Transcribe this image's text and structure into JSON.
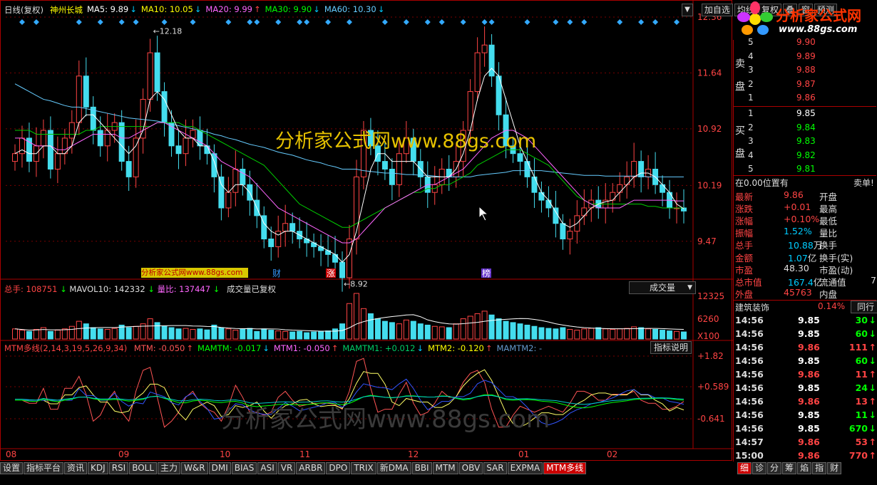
{
  "header": {
    "period": "日线(复权)",
    "stock_name": "神州长城",
    "ma": [
      {
        "label": "MA5: 9.89",
        "dir": "↓",
        "color": "#ffffff"
      },
      {
        "label": "MA10: 10.05",
        "dir": "↓",
        "color": "#ffff00"
      },
      {
        "label": "MA20: 9.99",
        "dir": "↑",
        "color": "#ff66ff"
      },
      {
        "label": "MA30: 9.90",
        "dir": "↓",
        "color": "#00ff00"
      },
      {
        "label": "MA60: 10.30",
        "dir": "↓",
        "color": "#66ccff"
      }
    ],
    "buttons": [
      "加自选",
      "均线",
      "复权",
      "叠",
      "窗",
      "预测"
    ]
  },
  "logo": {
    "title": "分析家公式网",
    "url": "www.88gs.com"
  },
  "watermark": "分析家公式网www.88gs.com",
  "watermark_box": "分析家公式网www.88gs.com",
  "price_axis": [
    "12.36",
    "11.64",
    "10.92",
    "10.19",
    "9.47"
  ],
  "annotations": {
    "high": "12.18",
    "low": "8.92",
    "tag_cai": "财",
    "tag_zhang": "涨",
    "tag_bang": "榜"
  },
  "volume_panel": {
    "total_label": "总手: 108751",
    "mavol_label": "MAVOL10: 142332",
    "lb_label": "量比: 137447",
    "note": "成交量已复权",
    "dropdown": "成交量",
    "axis": [
      "12325",
      "6260",
      "X100"
    ]
  },
  "mtm_panel": {
    "name": "MTM多线(2,14,3,19,5,26,9,34)",
    "items": [
      {
        "label": "MTM: -0.050",
        "dir": "↑",
        "color": "#ff5555"
      },
      {
        "label": "MAMTM: -0.017",
        "dir": "↓",
        "color": "#00ff00"
      },
      {
        "label": "MTM1: -0.050",
        "dir": "↑",
        "color": "#ff66ff"
      },
      {
        "label": "MAMTM1: +0.012",
        "dir": "↓",
        "color": "#00cc66"
      },
      {
        "label": "MTM2: -0.120",
        "dir": "↑",
        "color": "#ffff00"
      },
      {
        "label": "MAMTM2: -",
        "dir": "",
        "color": "#6699cc"
      }
    ],
    "help_button": "指标说明",
    "axis": [
      "+1.82",
      "+0.589",
      "-0.641"
    ]
  },
  "date_axis": [
    "08",
    "09",
    "10",
    "11",
    "12",
    "01",
    "02"
  ],
  "bottom_tabs": [
    "设置",
    "指标平台",
    "资讯",
    "KDJ",
    "RSI",
    "BOLL",
    "主力",
    "W&R",
    "DMI",
    "BIAS",
    "ASI",
    "VR",
    "ARBR",
    "DPO",
    "TRIX",
    "新DMA",
    "BBI",
    "MTM",
    "OBV",
    "SAR",
    "EXPMA",
    "MTM多线"
  ],
  "right_tabs": [
    "细",
    "诊",
    "分",
    "筹",
    "焰",
    "指",
    "财"
  ],
  "order_book": {
    "sell_label": [
      "卖",
      "盘"
    ],
    "buy_label": [
      "买",
      "盘"
    ],
    "sell": [
      {
        "n": "5",
        "p": "9.90"
      },
      {
        "n": "4",
        "p": "9.89"
      },
      {
        "n": "3",
        "p": "9.88"
      },
      {
        "n": "2",
        "p": "9.87"
      },
      {
        "n": "1",
        "p": "9.86"
      }
    ],
    "buy": [
      {
        "n": "1",
        "p": "9.85"
      },
      {
        "n": "2",
        "p": "9.84"
      },
      {
        "n": "3",
        "p": "9.83"
      },
      {
        "n": "4",
        "p": "9.82"
      },
      {
        "n": "5",
        "p": "9.81"
      }
    ]
  },
  "position": {
    "left": "在0.00位置有",
    "right": "卖单!"
  },
  "quote": [
    {
      "k": "最新",
      "v": "9.86",
      "vc": "#ff4444",
      "k2": "开盘"
    },
    {
      "k": "涨跌",
      "v": "+0.01",
      "vc": "#ff4444",
      "k2": "最高"
    },
    {
      "k": "涨幅",
      "v": "+0.10%",
      "vc": "#ff4444",
      "k2": "最低"
    },
    {
      "k": "振幅",
      "v": "1.52%",
      "vc": "#00ccff",
      "k2": "量比"
    },
    {
      "k": "总手",
      "v": "10.88",
      "u": "万",
      "vc": "#00ccff",
      "k2": "换手"
    },
    {
      "k": "金额",
      "v": "1.07",
      "u": "亿",
      "vc": "#00ccff",
      "k2": "换手(实)"
    },
    {
      "k": "市盈",
      "v": "48.30",
      "vc": "#dddddd",
      "k2": "市盈(动)"
    },
    {
      "k": "总市值",
      "v": "167.4",
      "u": "亿",
      "vc": "#00ccff",
      "k2": "流通值",
      "extra": "7"
    },
    {
      "k": "外盘",
      "v": "45763",
      "vc": "#ff4444",
      "k2": "内盘"
    }
  ],
  "sector": {
    "name": "建筑装饰",
    "pct": "0.14%",
    "btn": "同行"
  },
  "ticks": [
    {
      "t": "14:56",
      "p": "9.85",
      "pc": "#ffffff",
      "v": "30",
      "d": "↓",
      "c": "#00ff00"
    },
    {
      "t": "14:56",
      "p": "9.85",
      "pc": "#ffffff",
      "v": "60",
      "d": "↓",
      "c": "#00ff00"
    },
    {
      "t": "14:56",
      "p": "9.86",
      "pc": "#ff4444",
      "v": "111",
      "d": "↑",
      "c": "#ff4444"
    },
    {
      "t": "14:56",
      "p": "9.85",
      "pc": "#ffffff",
      "v": "60",
      "d": "↓",
      "c": "#00ff00"
    },
    {
      "t": "14:56",
      "p": "9.86",
      "pc": "#ff4444",
      "v": "11",
      "d": "↑",
      "c": "#ff4444"
    },
    {
      "t": "14:56",
      "p": "9.85",
      "pc": "#ffffff",
      "v": "24",
      "d": "↓",
      "c": "#00ff00"
    },
    {
      "t": "14:56",
      "p": "9.86",
      "pc": "#ff4444",
      "v": "13",
      "d": "↑",
      "c": "#ff4444"
    },
    {
      "t": "14:56",
      "p": "9.85",
      "pc": "#ffffff",
      "v": "11",
      "d": "↓",
      "c": "#00ff00"
    },
    {
      "t": "14:56",
      "p": "9.85",
      "pc": "#ffffff",
      "v": "670",
      "d": "↓",
      "c": "#00ff00"
    },
    {
      "t": "14:57",
      "p": "9.86",
      "pc": "#ff4444",
      "v": "53",
      "d": "↑",
      "c": "#ff4444"
    },
    {
      "t": "15:00",
      "p": "9.86",
      "pc": "#ff4444",
      "v": "770",
      "d": "↑",
      "c": "#ff4444"
    }
  ],
  "chart_data": {
    "type": "candlestick",
    "x": [
      "08",
      "09",
      "10",
      "11",
      "12",
      "01",
      "02"
    ],
    "ylim": [
      9.0,
      12.36
    ],
    "price_ticks": [
      12.36,
      11.64,
      10.92,
      10.19,
      9.47
    ],
    "high_marker": 12.18,
    "low_marker": 8.92,
    "close": [
      10.6,
      10.8,
      10.5,
      10.7,
      10.9,
      10.4,
      10.6,
      10.8,
      11.0,
      11.6,
      11.2,
      10.9,
      10.7,
      10.9,
      11.0,
      10.5,
      10.3,
      10.8,
      11.3,
      11.9,
      11.4,
      11.0,
      10.7,
      10.6,
      10.8,
      10.9,
      10.7,
      10.6,
      10.3,
      9.9,
      10.1,
      10.4,
      10.2,
      10.0,
      9.8,
      9.5,
      9.4,
      9.6,
      9.7,
      9.6,
      9.5,
      9.45,
      9.4,
      9.35,
      9.3,
      9.2,
      9.0,
      9.5,
      10.3,
      10.9,
      10.7,
      10.5,
      10.4,
      10.2,
      10.6,
      10.8,
      10.5,
      10.3,
      10.1,
      10.2,
      10.4,
      10.3,
      10.5,
      10.9,
      11.4,
      11.9,
      12.0,
      11.6,
      11.1,
      10.7,
      10.6,
      10.5,
      10.3,
      10.1,
      10.0,
      9.9,
      9.7,
      9.5,
      9.6,
      9.8,
      9.9,
      10.0,
      9.9,
      10.0,
      10.1,
      10.2,
      10.3,
      10.5,
      10.3,
      10.4,
      10.2,
      10.1,
      9.9,
      9.9,
      9.86
    ],
    "ma5": [
      10.6,
      10.65,
      10.6,
      10.6,
      10.7,
      10.7,
      10.6,
      10.6,
      10.7,
      11.0,
      11.1,
      11.1,
      11.0,
      10.9,
      10.8,
      10.7,
      10.6,
      10.7,
      10.9,
      11.3,
      11.4,
      11.3,
      11.1,
      10.9,
      10.8,
      10.8,
      10.7,
      10.7,
      10.5,
      10.2,
      10.1,
      10.2,
      10.2,
      10.1,
      9.9,
      9.7,
      9.6,
      9.55,
      9.6,
      9.6,
      9.55,
      9.5,
      9.45,
      9.4,
      9.35,
      9.3,
      9.2,
      9.3,
      9.6,
      10.0,
      10.4,
      10.6,
      10.6,
      10.5,
      10.5,
      10.5,
      10.5,
      10.4,
      10.3,
      10.3,
      10.3,
      10.3,
      10.4,
      10.6,
      10.9,
      11.3,
      11.6,
      11.7,
      11.6,
      11.3,
      11.0,
      10.7,
      10.5,
      10.3,
      10.1,
      10.0,
      9.85,
      9.7,
      9.65,
      9.7,
      9.8,
      9.9,
      9.95,
      9.98,
      10.0,
      10.1,
      10.2,
      10.3,
      10.35,
      10.35,
      10.3,
      10.2,
      10.1,
      9.95,
      9.89
    ],
    "ma20": [
      10.8,
      10.8,
      10.75,
      10.7,
      10.7,
      10.7,
      10.65,
      10.65,
      10.7,
      10.75,
      10.8,
      10.85,
      10.85,
      10.85,
      10.85,
      10.8,
      10.8,
      10.85,
      10.9,
      10.95,
      11.0,
      11.0,
      10.95,
      10.9,
      10.85,
      10.8,
      10.75,
      10.7,
      10.6,
      10.5,
      10.45,
      10.4,
      10.35,
      10.3,
      10.2,
      10.1,
      10.0,
      9.9,
      9.85,
      9.8,
      9.75,
      9.7,
      9.65,
      9.6,
      9.55,
      9.5,
      9.45,
      9.45,
      9.5,
      9.6,
      9.7,
      9.8,
      9.9,
      9.95,
      10.0,
      10.05,
      10.1,
      10.15,
      10.2,
      10.2,
      10.25,
      10.3,
      10.35,
      10.4,
      10.5,
      10.6,
      10.7,
      10.8,
      10.85,
      10.9,
      10.9,
      10.85,
      10.8,
      10.7,
      10.6,
      10.5,
      10.4,
      10.3,
      10.2,
      10.1,
      10.0,
      9.95,
      9.9,
      9.9,
      9.9,
      9.9,
      9.95,
      10.0,
      10.0,
      10.0,
      10.0,
      10.0,
      10.0,
      9.99,
      9.99
    ],
    "ma30": [
      10.9,
      10.9,
      10.9,
      10.85,
      10.85,
      10.85,
      10.85,
      10.85,
      10.85,
      10.85,
      10.9,
      10.9,
      10.95,
      10.95,
      10.95,
      10.95,
      10.95,
      10.95,
      10.95,
      10.95,
      11.0,
      11.0,
      11.0,
      11.0,
      10.95,
      10.95,
      10.9,
      10.85,
      10.8,
      10.75,
      10.7,
      10.65,
      10.6,
      10.55,
      10.5,
      10.45,
      10.35,
      10.25,
      10.15,
      10.05,
      9.95,
      9.9,
      9.85,
      9.8,
      9.75,
      9.7,
      9.65,
      9.65,
      9.7,
      9.75,
      9.8,
      9.85,
      9.9,
      9.95,
      10.0,
      10.05,
      10.1,
      10.1,
      10.15,
      10.15,
      10.2,
      10.2,
      10.25,
      10.3,
      10.35,
      10.45,
      10.5,
      10.55,
      10.6,
      10.65,
      10.65,
      10.65,
      10.6,
      10.55,
      10.5,
      10.45,
      10.35,
      10.25,
      10.15,
      10.05,
      10.0,
      9.95,
      9.95,
      9.95,
      9.95,
      9.95,
      9.95,
      9.95,
      9.95,
      9.92,
      9.92,
      9.9,
      9.9,
      9.9,
      9.9
    ],
    "ma60": [
      11.5,
      11.45,
      11.4,
      11.35,
      11.3,
      11.28,
      11.25,
      11.22,
      11.2,
      11.2,
      11.18,
      11.16,
      11.14,
      11.12,
      11.1,
      11.08,
      11.06,
      11.05,
      11.04,
      11.03,
      11.02,
      11.0,
      10.98,
      10.96,
      10.94,
      10.92,
      10.9,
      10.88,
      10.85,
      10.83,
      10.8,
      10.78,
      10.75,
      10.72,
      10.7,
      10.68,
      10.65,
      10.62,
      10.6,
      10.58,
      10.55,
      10.52,
      10.5,
      10.48,
      10.45,
      10.43,
      10.4,
      10.4,
      10.4,
      10.38,
      10.37,
      10.36,
      10.35,
      10.35,
      10.34,
      10.33,
      10.33,
      10.32,
      10.32,
      10.31,
      10.3,
      10.3,
      10.3,
      10.3,
      10.3,
      10.32,
      10.33,
      10.34,
      10.35,
      10.36,
      10.38,
      10.38,
      10.38,
      10.38,
      10.38,
      10.37,
      10.36,
      10.35,
      10.34,
      10.33,
      10.32,
      10.32,
      10.32,
      10.31,
      10.31,
      10.31,
      10.31,
      10.31,
      10.31,
      10.3,
      10.3,
      10.3,
      10.3,
      10.3,
      10.3
    ],
    "volume": [
      40,
      35,
      30,
      38,
      45,
      30,
      35,
      40,
      50,
      70,
      60,
      45,
      40,
      38,
      42,
      55,
      45,
      50,
      60,
      80,
      65,
      50,
      45,
      40,
      42,
      38,
      40,
      36,
      55,
      45,
      40,
      35,
      38,
      42,
      30,
      40,
      35,
      32,
      30,
      28,
      30,
      25,
      28,
      30,
      32,
      40,
      60,
      140,
      180,
      120,
      100,
      80,
      70,
      65,
      60,
      75,
      70,
      60,
      55,
      50,
      48,
      45,
      60,
      80,
      90,
      100,
      110,
      95,
      80,
      70,
      65,
      60,
      55,
      50,
      45,
      42,
      40,
      45,
      38,
      35,
      40,
      42,
      45,
      40,
      38,
      40,
      42,
      48,
      45,
      40,
      38,
      35,
      32,
      30,
      28
    ],
    "mavol_ylim": [
      0,
      12325
    ]
  }
}
